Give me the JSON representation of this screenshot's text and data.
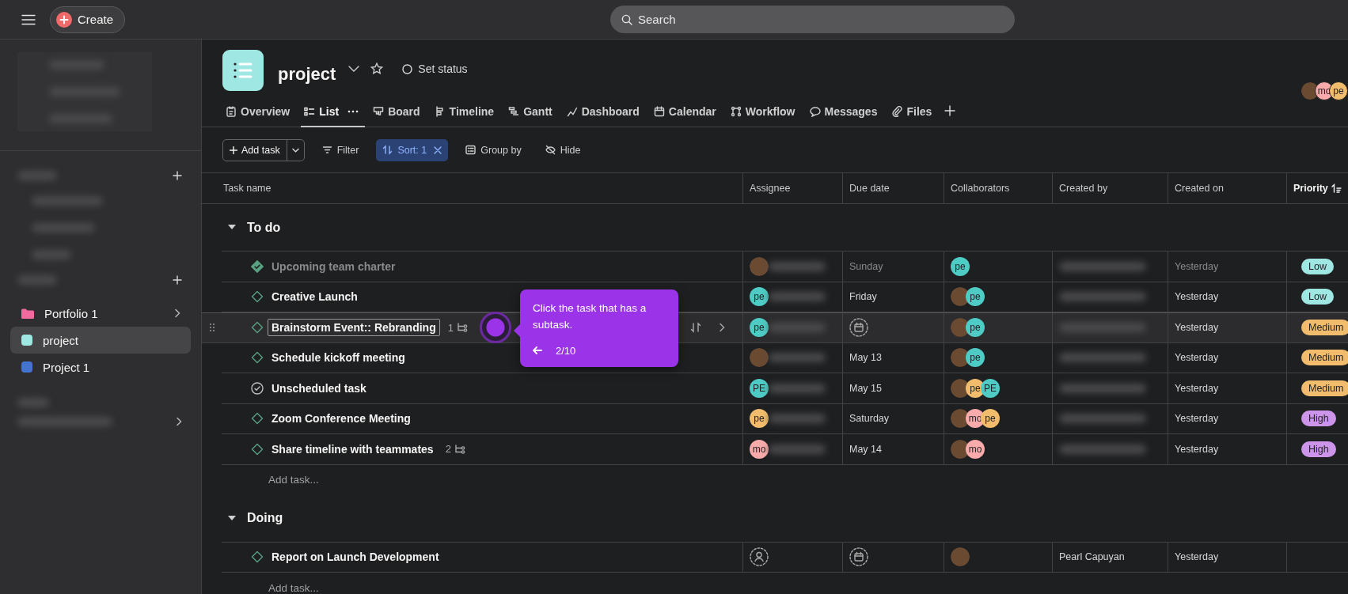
{
  "topbar": {
    "create_label": "Create",
    "search_placeholder": "Search"
  },
  "sidebar": {
    "items": [
      {
        "kind": "folder",
        "label": "Portfolio 1",
        "color": "#f06a9f",
        "selected": false
      },
      {
        "kind": "project",
        "label": "project",
        "color": "#9ee7e3",
        "selected": true
      },
      {
        "kind": "project",
        "label": "Project 1",
        "color": "#4573d2",
        "selected": false
      }
    ]
  },
  "project": {
    "title": "project",
    "color": "#9ee7e3",
    "status_label": "Set status",
    "members": [
      {
        "kind": "photo"
      },
      {
        "kind": "initials",
        "initials": "mo",
        "color": "#f9aaaa"
      },
      {
        "kind": "initials",
        "initials": "pe",
        "color": "#f1bd6c"
      }
    ]
  },
  "tabs": [
    {
      "label": "Overview",
      "selected": false
    },
    {
      "label": "List",
      "selected": true
    },
    {
      "label": "Board",
      "selected": false
    },
    {
      "label": "Timeline",
      "selected": false
    },
    {
      "label": "Gantt",
      "selected": false
    },
    {
      "label": "Dashboard",
      "selected": false
    },
    {
      "label": "Calendar",
      "selected": false
    },
    {
      "label": "Workflow",
      "selected": false
    },
    {
      "label": "Messages",
      "selected": false
    },
    {
      "label": "Files",
      "selected": false
    }
  ],
  "toolbar": {
    "add_task": "Add task",
    "filter": "Filter",
    "sort": {
      "label": "Sort: 1",
      "active": true
    },
    "group_by": "Group by",
    "hide": "Hide"
  },
  "table": {
    "columns": [
      {
        "label": "Task name",
        "sorted": false
      },
      {
        "label": "Assignee",
        "sorted": false
      },
      {
        "label": "Due date",
        "sorted": false
      },
      {
        "label": "Collaborators",
        "sorted": false
      },
      {
        "label": "Created by",
        "sorted": false
      },
      {
        "label": "Created on",
        "sorted": false
      },
      {
        "label": "Priority",
        "sorted": true
      }
    ],
    "groups": [
      {
        "name": "To do",
        "expanded": true,
        "add_task": "Add task...",
        "tasks": [
          {
            "name": "Upcoming team charter",
            "kind": "milestone",
            "completed": true,
            "highlighted": false,
            "assignee": {
              "kind": "photo"
            },
            "due": "Sunday",
            "collaborators": [
              {
                "kind": "initials",
                "initials": "pe",
                "color": "#4ecbc4"
              }
            ],
            "created_on": "Yesterday",
            "priority": {
              "label": "Low",
              "color": "#9ee7e3"
            }
          },
          {
            "name": "Creative Launch",
            "kind": "milestone",
            "completed": false,
            "highlighted": false,
            "assignee": {
              "kind": "initials",
              "initials": "pe",
              "color": "#4ecbc4"
            },
            "due": "Friday",
            "collaborators": [
              {
                "kind": "photo"
              },
              {
                "kind": "initials",
                "initials": "pe",
                "color": "#4ecbc4"
              }
            ],
            "created_on": "Yesterday",
            "priority": {
              "label": "Low",
              "color": "#9ee7e3"
            }
          },
          {
            "name": "Brainstorm Event:: Rebranding",
            "kind": "milestone",
            "completed": false,
            "highlighted": true,
            "subtasks": "1",
            "assignee": {
              "kind": "initials",
              "initials": "pe",
              "color": "#4ecbc4"
            },
            "collaborators": [
              {
                "kind": "photo"
              },
              {
                "kind": "initials",
                "initials": "pe",
                "color": "#4ecbc4"
              }
            ],
            "created_on": "Yesterday",
            "priority": {
              "label": "Medium",
              "color": "#f1bd6c"
            }
          },
          {
            "name": "Schedule kickoff meeting",
            "kind": "milestone",
            "completed": false,
            "highlighted": false,
            "assignee": {
              "kind": "photo"
            },
            "due": "May 13",
            "collaborators": [
              {
                "kind": "photo"
              },
              {
                "kind": "initials",
                "initials": "pe",
                "color": "#4ecbc4"
              }
            ],
            "created_on": "Yesterday",
            "priority": {
              "label": "Medium",
              "color": "#f1bd6c"
            }
          },
          {
            "name": "Unscheduled task",
            "kind": "task",
            "completed": false,
            "highlighted": false,
            "assignee": {
              "kind": "initials",
              "initials": "PE",
              "color": "#4ecbc4"
            },
            "due": "May 15",
            "collaborators": [
              {
                "kind": "photo"
              },
              {
                "kind": "initials",
                "initials": "pe",
                "color": "#f1bd6c"
              },
              {
                "kind": "initials",
                "initials": "PE",
                "color": "#4ecbc4"
              }
            ],
            "created_on": "Yesterday",
            "priority": {
              "label": "Medium",
              "color": "#f1bd6c"
            }
          },
          {
            "name": "Zoom Conference Meeting",
            "kind": "milestone",
            "completed": false,
            "highlighted": false,
            "assignee": {
              "kind": "initials",
              "initials": "pe",
              "color": "#f1bd6c"
            },
            "due": "Saturday",
            "collaborators": [
              {
                "kind": "photo"
              },
              {
                "kind": "initials",
                "initials": "mo",
                "color": "#f9aaaa"
              },
              {
                "kind": "initials",
                "initials": "pe",
                "color": "#f1bd6c"
              }
            ],
            "created_on": "Yesterday",
            "priority": {
              "label": "High",
              "color": "#cd95ea"
            }
          },
          {
            "name": "Share timeline with teammates",
            "kind": "milestone",
            "completed": false,
            "highlighted": false,
            "subtasks": "2",
            "assignee": {
              "kind": "initials",
              "initials": "mo",
              "color": "#f9aaaa"
            },
            "due": "May 14",
            "collaborators": [
              {
                "kind": "photo"
              },
              {
                "kind": "initials",
                "initials": "mo",
                "color": "#f9aaaa"
              }
            ],
            "created_on": "Yesterday",
            "priority": {
              "label": "High",
              "color": "#cd95ea"
            }
          }
        ]
      },
      {
        "name": "Doing",
        "expanded": true,
        "add_task": "Add task...",
        "tasks": [
          {
            "name": "Report on Launch Development",
            "kind": "milestone",
            "completed": false,
            "highlighted": false,
            "collaborators": [
              {
                "kind": "photo"
              }
            ],
            "created_by": "Pearl Capuyan",
            "created_on": "Yesterday"
          }
        ]
      }
    ]
  },
  "tooltip": {
    "text": "Click the task that has a subtask.",
    "step": "2/10"
  }
}
